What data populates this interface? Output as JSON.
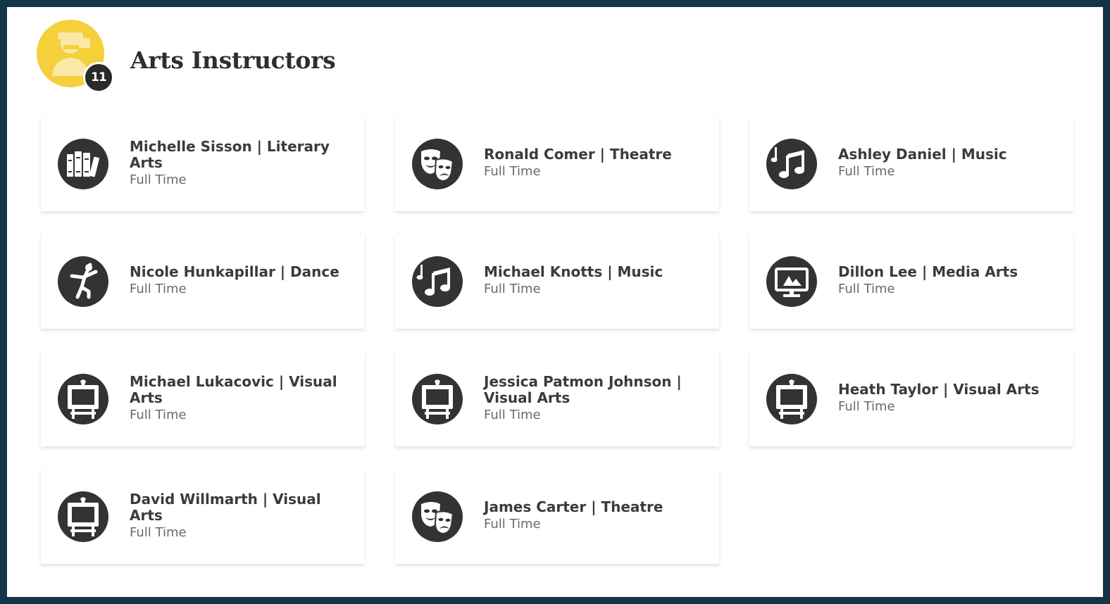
{
  "header": {
    "title": "Arts Instructors",
    "count": "11",
    "icon": "instructor-icon",
    "icon_color": "#f5d03a"
  },
  "instructors": [
    {
      "name": "Michelle Sisson | Literary Arts",
      "status": "Full Time",
      "icon": "books-icon"
    },
    {
      "name": "Ronald Comer | Theatre",
      "status": "Full Time",
      "icon": "theatre-masks-icon"
    },
    {
      "name": "Ashley Daniel | Music",
      "status": "Full Time",
      "icon": "music-note-icon"
    },
    {
      "name": "Nicole Hunkapillar | Dance",
      "status": "Full Time",
      "icon": "dancer-icon"
    },
    {
      "name": "Michael Knotts | Music",
      "status": "Full Time",
      "icon": "music-note-icon"
    },
    {
      "name": "Dillon Lee | Media Arts",
      "status": "Full Time",
      "icon": "monitor-icon"
    },
    {
      "name": "Michael Lukacovic | Visual Arts",
      "status": "Full Time",
      "icon": "easel-icon"
    },
    {
      "name": "Jessica Patmon Johnson | Visual Arts",
      "status": "Full Time",
      "icon": "easel-icon"
    },
    {
      "name": "Heath Taylor | Visual Arts",
      "status": "Full Time",
      "icon": "easel-icon"
    },
    {
      "name": "David Willmarth | Visual Arts",
      "status": "Full Time",
      "icon": "easel-icon"
    },
    {
      "name": "James Carter | Theatre",
      "status": "Full Time",
      "icon": "theatre-masks-icon"
    }
  ]
}
